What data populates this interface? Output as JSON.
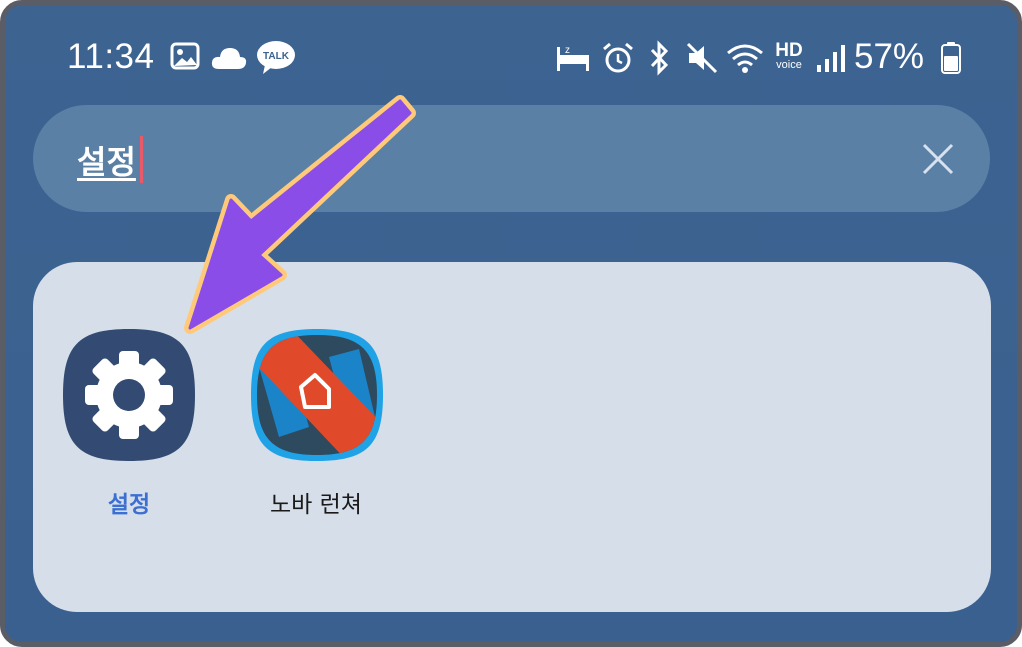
{
  "status_bar": {
    "time": "11:34",
    "battery_percent": "57%",
    "battery_level": 0.57,
    "talk_badge": "TALK",
    "hd_label": "HD",
    "voice_label": "voice",
    "icons": [
      "gallery-icon",
      "cloud-icon",
      "kakaotalk-icon",
      "sleep-mode-icon",
      "alarm-icon",
      "bluetooth-icon",
      "mute-icon",
      "wifi-icon",
      "hd-voice-icon",
      "signal-icon",
      "battery-icon"
    ]
  },
  "search": {
    "query": "설정",
    "clear_icon": "close-icon"
  },
  "results": {
    "apps": [
      {
        "label": "설정",
        "icon": "gear-icon",
        "highlighted": true
      },
      {
        "label": "노바 런쳐",
        "icon": "nova-launcher-icon",
        "highlighted": false
      }
    ]
  },
  "annotation": {
    "arrow_color": "#8a4de8",
    "arrow_outline": "#ffc97a"
  },
  "colors": {
    "background": "#3d6391",
    "search_bg": "#5b80a6",
    "card_bg": "#d6dee9",
    "highlight_label": "#3b6fd1"
  }
}
